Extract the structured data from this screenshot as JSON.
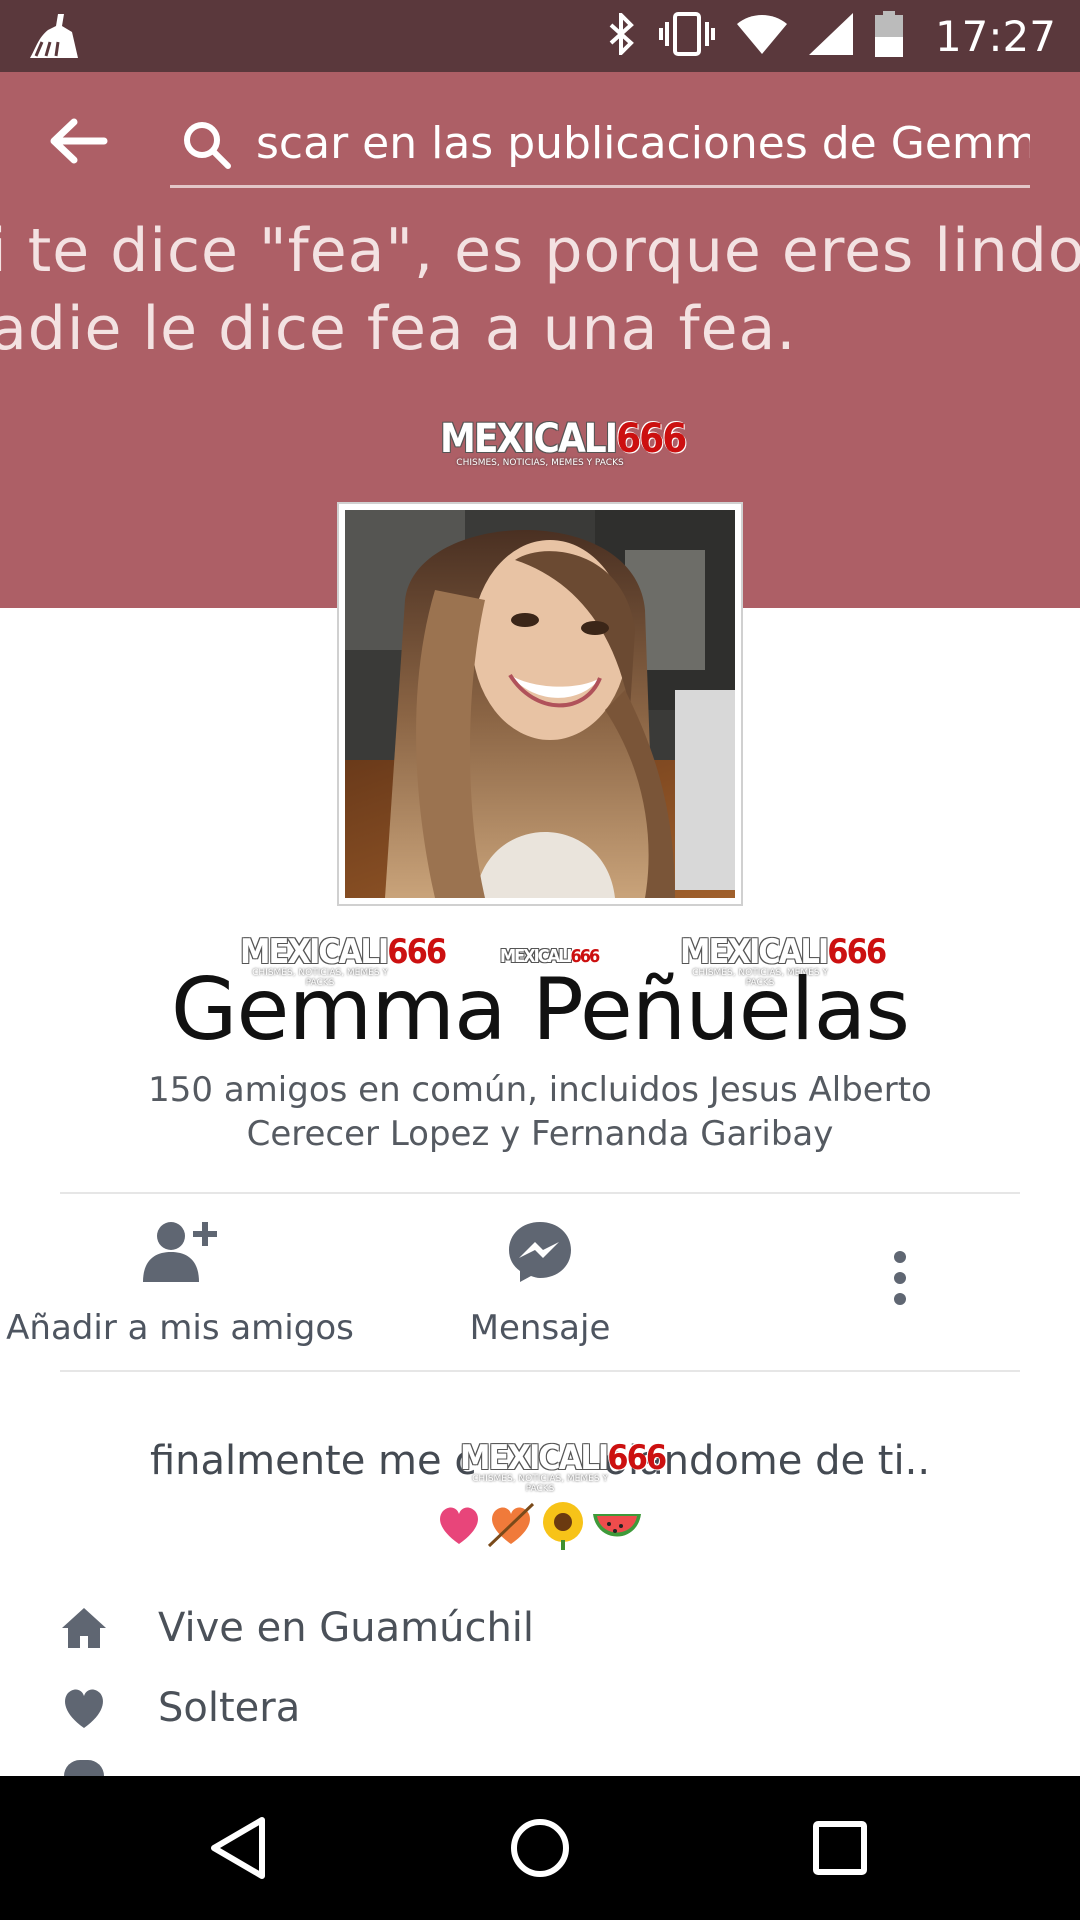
{
  "status_bar": {
    "time": "17:27",
    "icons": [
      "cleaner-icon",
      "bluetooth-icon",
      "vibrate-icon",
      "wifi-icon",
      "signal-icon",
      "battery-icon"
    ]
  },
  "header": {
    "search_text": "scar en las publicaciones de Gemma"
  },
  "cover": {
    "quote_line1": "i te dice \"fea\", es porque eres lindo",
    "quote_line2": "adie le dice fea a una fea.",
    "color": "#ad5f66"
  },
  "watermark": {
    "part1": "MEXICALI",
    "part2": "666",
    "sub": "CHISMES, NOTICIAS, MEMES Y PACKS"
  },
  "profile": {
    "name": "Gemma Peñuelas",
    "mutual_friends": "150 amigos en común, incluidos Jesus Alberto Cerecer Lopez y Fernanda Garibay"
  },
  "actions": {
    "add_friend": "Añadir a mis amigos",
    "message": "Mensaje"
  },
  "bio": {
    "text": "finalmente me c          olandome de ti.."
  },
  "info": {
    "lives_in": "Vive en Guamúchil",
    "relationship": "Soltera"
  },
  "colors": {
    "status_bar": "#5a383c",
    "icon_gray": "#5f6672"
  }
}
